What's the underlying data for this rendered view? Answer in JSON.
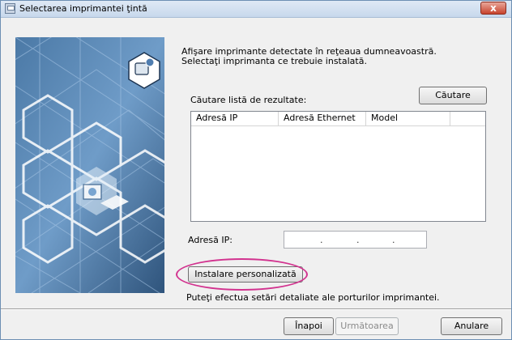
{
  "window": {
    "title": "Selectarea imprimantei ţintă",
    "close_label": "x"
  },
  "instructions": {
    "line1": "Afişare imprimante detectate în reţeaua dumneavoastră.",
    "line2": "Selectaţi imprimanta ce trebuie instalată."
  },
  "search": {
    "label": "Căutare listă de rezultate:",
    "button": "Căutare"
  },
  "results_table": {
    "columns": [
      "Adresă IP",
      "Adresă Ethernet",
      "Model"
    ],
    "rows": []
  },
  "ip_address": {
    "label": "Adresă IP:",
    "value": ". . ."
  },
  "custom_install": {
    "button": "Instalare personalizată",
    "description": "Puteţi efectua setări detaliate ale porturilor imprimantei."
  },
  "footer": {
    "back": "Înapoi",
    "next": "Următoarea",
    "cancel": "Anulare"
  },
  "colors": {
    "side_image_bg": "#3a638e",
    "highlight_ring": "#d2338f"
  },
  "icons": [
    "printer-icon",
    "network-printer-icon",
    "hexagon-pattern"
  ]
}
